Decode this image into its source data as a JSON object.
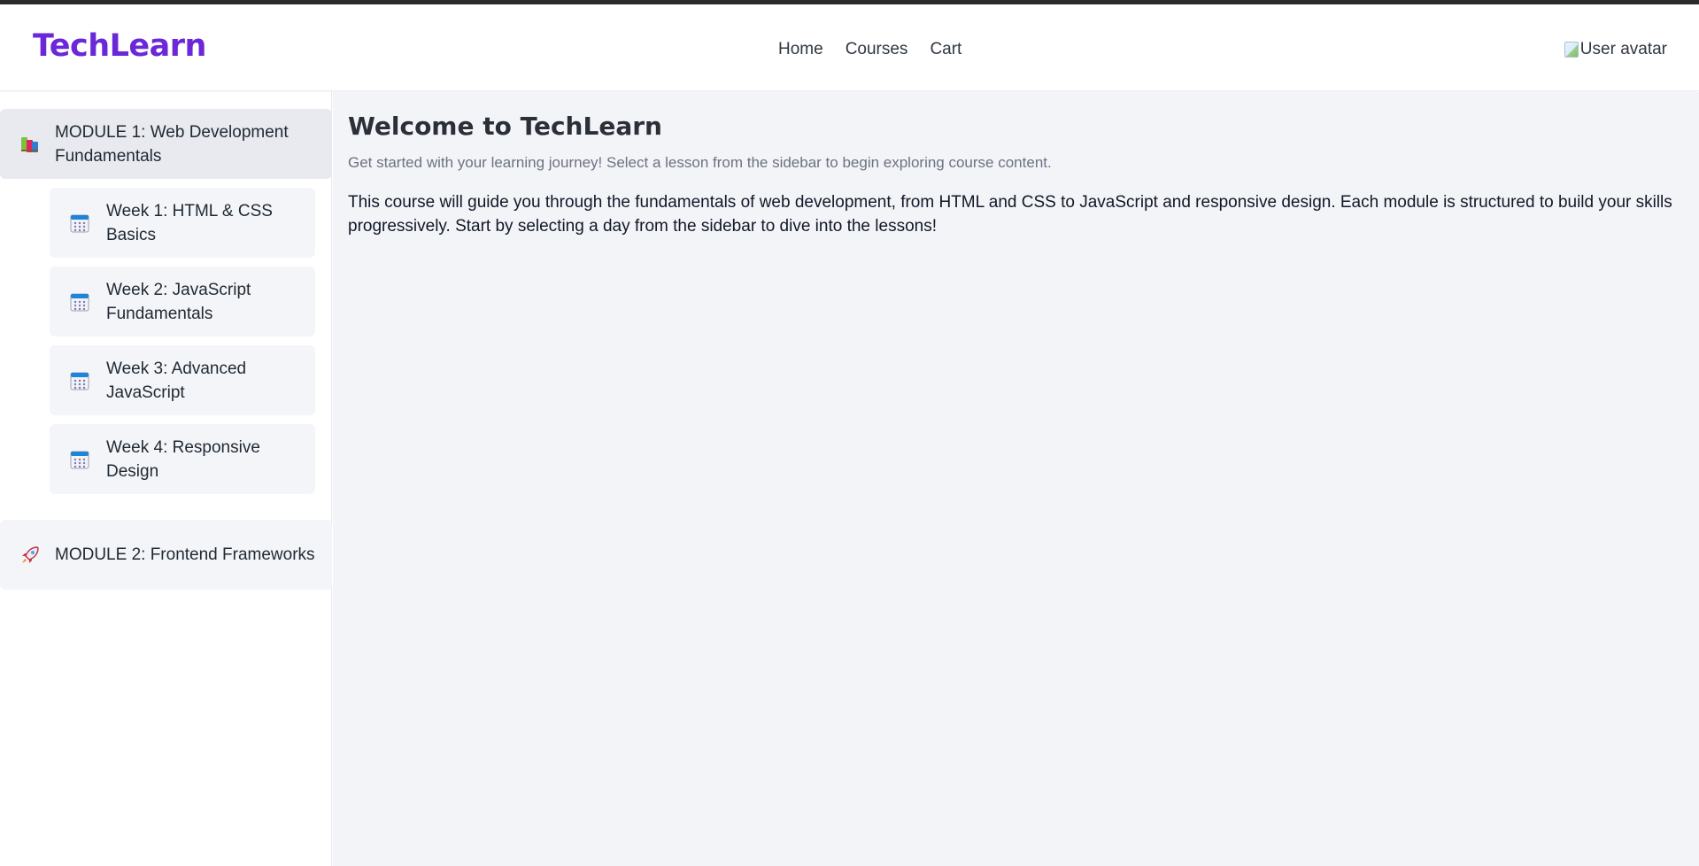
{
  "app": {
    "logo": "TechLearn"
  },
  "nav": {
    "items": [
      {
        "label": "Home"
      },
      {
        "label": "Courses"
      },
      {
        "label": "Cart"
      }
    ]
  },
  "user": {
    "avatar_alt": "User avatar"
  },
  "sidebar": {
    "modules": [
      {
        "label": "MODULE 1: Web Development Fundamentals",
        "icon": "books-icon",
        "expanded": true,
        "weeks": [
          {
            "label": "Week 1: HTML & CSS Basics",
            "icon": "calendar-icon"
          },
          {
            "label": "Week 2: JavaScript Fundamentals",
            "icon": "calendar-icon"
          },
          {
            "label": "Week 3: Advanced JavaScript",
            "icon": "calendar-icon"
          },
          {
            "label": "Week 4: Responsive Design",
            "icon": "calendar-icon"
          }
        ]
      },
      {
        "label": "MODULE 2: Frontend Frameworks",
        "icon": "rocket-icon",
        "expanded": false
      }
    ]
  },
  "main": {
    "title": "Welcome to TechLearn",
    "subtitle": "Get started with your learning journey! Select a lesson from the sidebar to begin exploring course content.",
    "body": "This course will guide you through the fundamentals of web development, from HTML and CSS to JavaScript and responsive design. Each module is structured to build your skills progressively. Start by selecting a day from the sidebar to dive into the lessons!"
  },
  "colors": {
    "brand": "#6a28d8",
    "top_strip": "#2b2b2b",
    "main_bg": "#f3f4f8"
  }
}
